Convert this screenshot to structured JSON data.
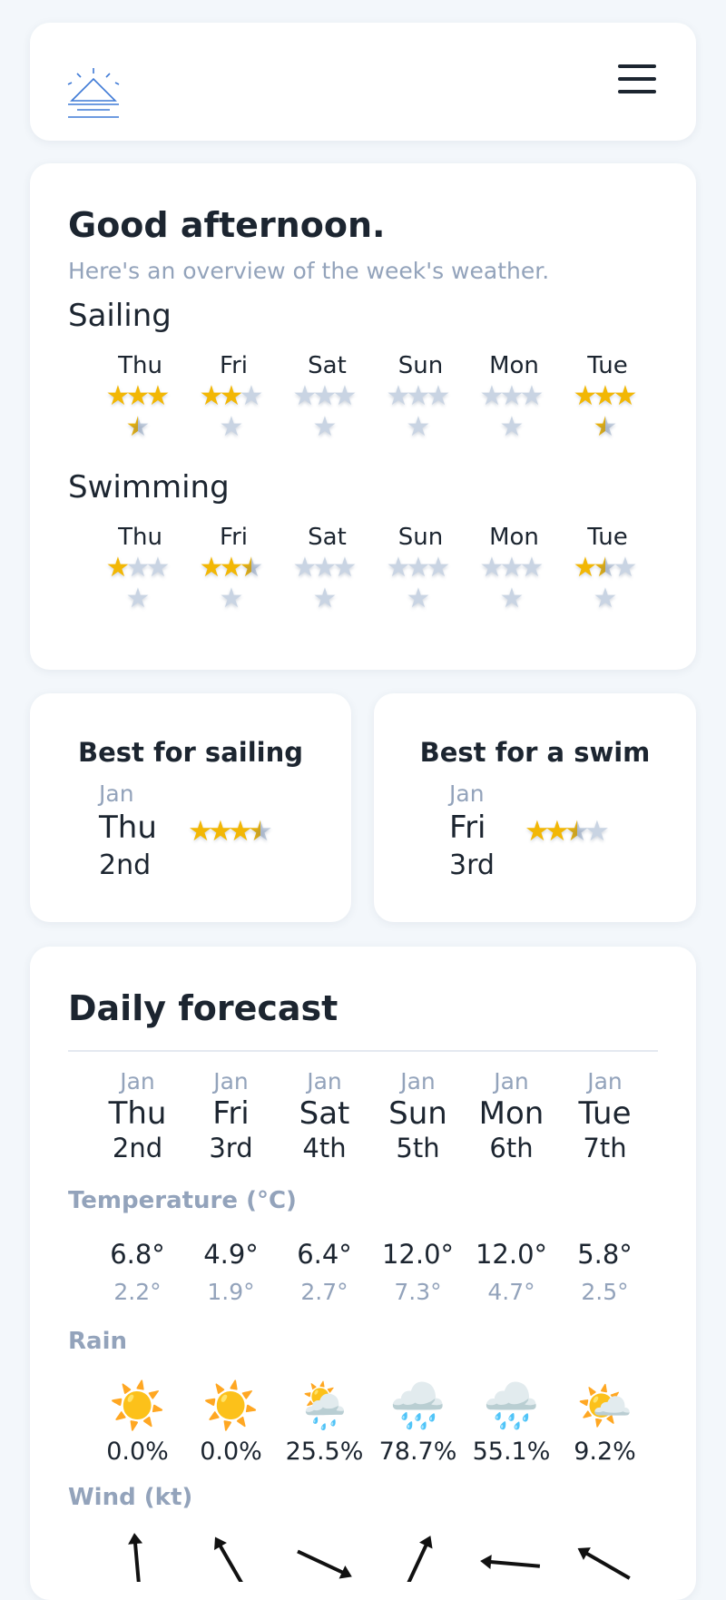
{
  "header": {
    "logo_icon": "sunrise-icon",
    "menu_icon": "hamburger-menu-icon"
  },
  "overview": {
    "greeting": "Good afternoon.",
    "subtitle": "Here's an overview of the week's weather.",
    "sailing": {
      "title": "Sailing",
      "days": [
        {
          "day": "Thu",
          "rating": 3.5
        },
        {
          "day": "Fri",
          "rating": 2
        },
        {
          "day": "Sat",
          "rating": 0
        },
        {
          "day": "Sun",
          "rating": 0
        },
        {
          "day": "Mon",
          "rating": 0
        },
        {
          "day": "Tue",
          "rating": 3.5
        }
      ]
    },
    "swimming": {
      "title": "Swimming",
      "days": [
        {
          "day": "Thu",
          "rating": 1
        },
        {
          "day": "Fri",
          "rating": 2.5
        },
        {
          "day": "Sat",
          "rating": 0
        },
        {
          "day": "Sun",
          "rating": 0
        },
        {
          "day": "Mon",
          "rating": 0
        },
        {
          "day": "Tue",
          "rating": 1.5
        }
      ]
    }
  },
  "best_sailing": {
    "title": "Best for sailing",
    "month": "Jan",
    "day": "Thu",
    "date": "2nd",
    "rating": 3.5
  },
  "best_swim": {
    "title": "Best for a swim",
    "month": "Jan",
    "day": "Fri",
    "date": "3rd",
    "rating": 2.5
  },
  "daily": {
    "title": "Daily forecast",
    "temperature_label": "Temperature (°C)",
    "rain_label": "Rain",
    "wind_label": "Wind (kt)",
    "days": [
      {
        "month": "Jan",
        "day": "Thu",
        "date": "2nd",
        "high": "6.8°",
        "low": "2.2°",
        "icon": "sun-icon",
        "glyph": "☀️",
        "rain": "0.0%",
        "wind_dir_deg": 175
      },
      {
        "month": "Jan",
        "day": "Fri",
        "date": "3rd",
        "high": "4.9°",
        "low": "1.9°",
        "icon": "sun-icon",
        "glyph": "☀️",
        "rain": "0.0%",
        "wind_dir_deg": 150
      },
      {
        "month": "Jan",
        "day": "Sat",
        "date": "4th",
        "high": "6.4°",
        "low": "2.7°",
        "icon": "sun-rain-cloud-icon",
        "glyph": "🌦️",
        "rain": "25.5%",
        "wind_dir_deg": 295
      },
      {
        "month": "Jan",
        "day": "Sun",
        "date": "5th",
        "high": "12.0°",
        "low": "7.3°",
        "icon": "rain-cloud-icon",
        "glyph": "🌧️",
        "rain": "78.7%",
        "wind_dir_deg": 205
      },
      {
        "month": "Jan",
        "day": "Mon",
        "date": "6th",
        "high": "12.0°",
        "low": "4.7°",
        "icon": "rain-cloud-icon",
        "glyph": "🌧️",
        "rain": "55.1%",
        "wind_dir_deg": 95
      },
      {
        "month": "Jan",
        "day": "Tue",
        "date": "7th",
        "high": "5.8°",
        "low": "2.5°",
        "icon": "sun-cloud-icon",
        "glyph": "🌤️",
        "rain": "9.2%",
        "wind_dir_deg": 120
      }
    ]
  },
  "colors": {
    "star_on": "#f2b705",
    "star_off": "#c9d4e3",
    "muted": "#93a3bb",
    "accent": "#3f7ad6"
  }
}
